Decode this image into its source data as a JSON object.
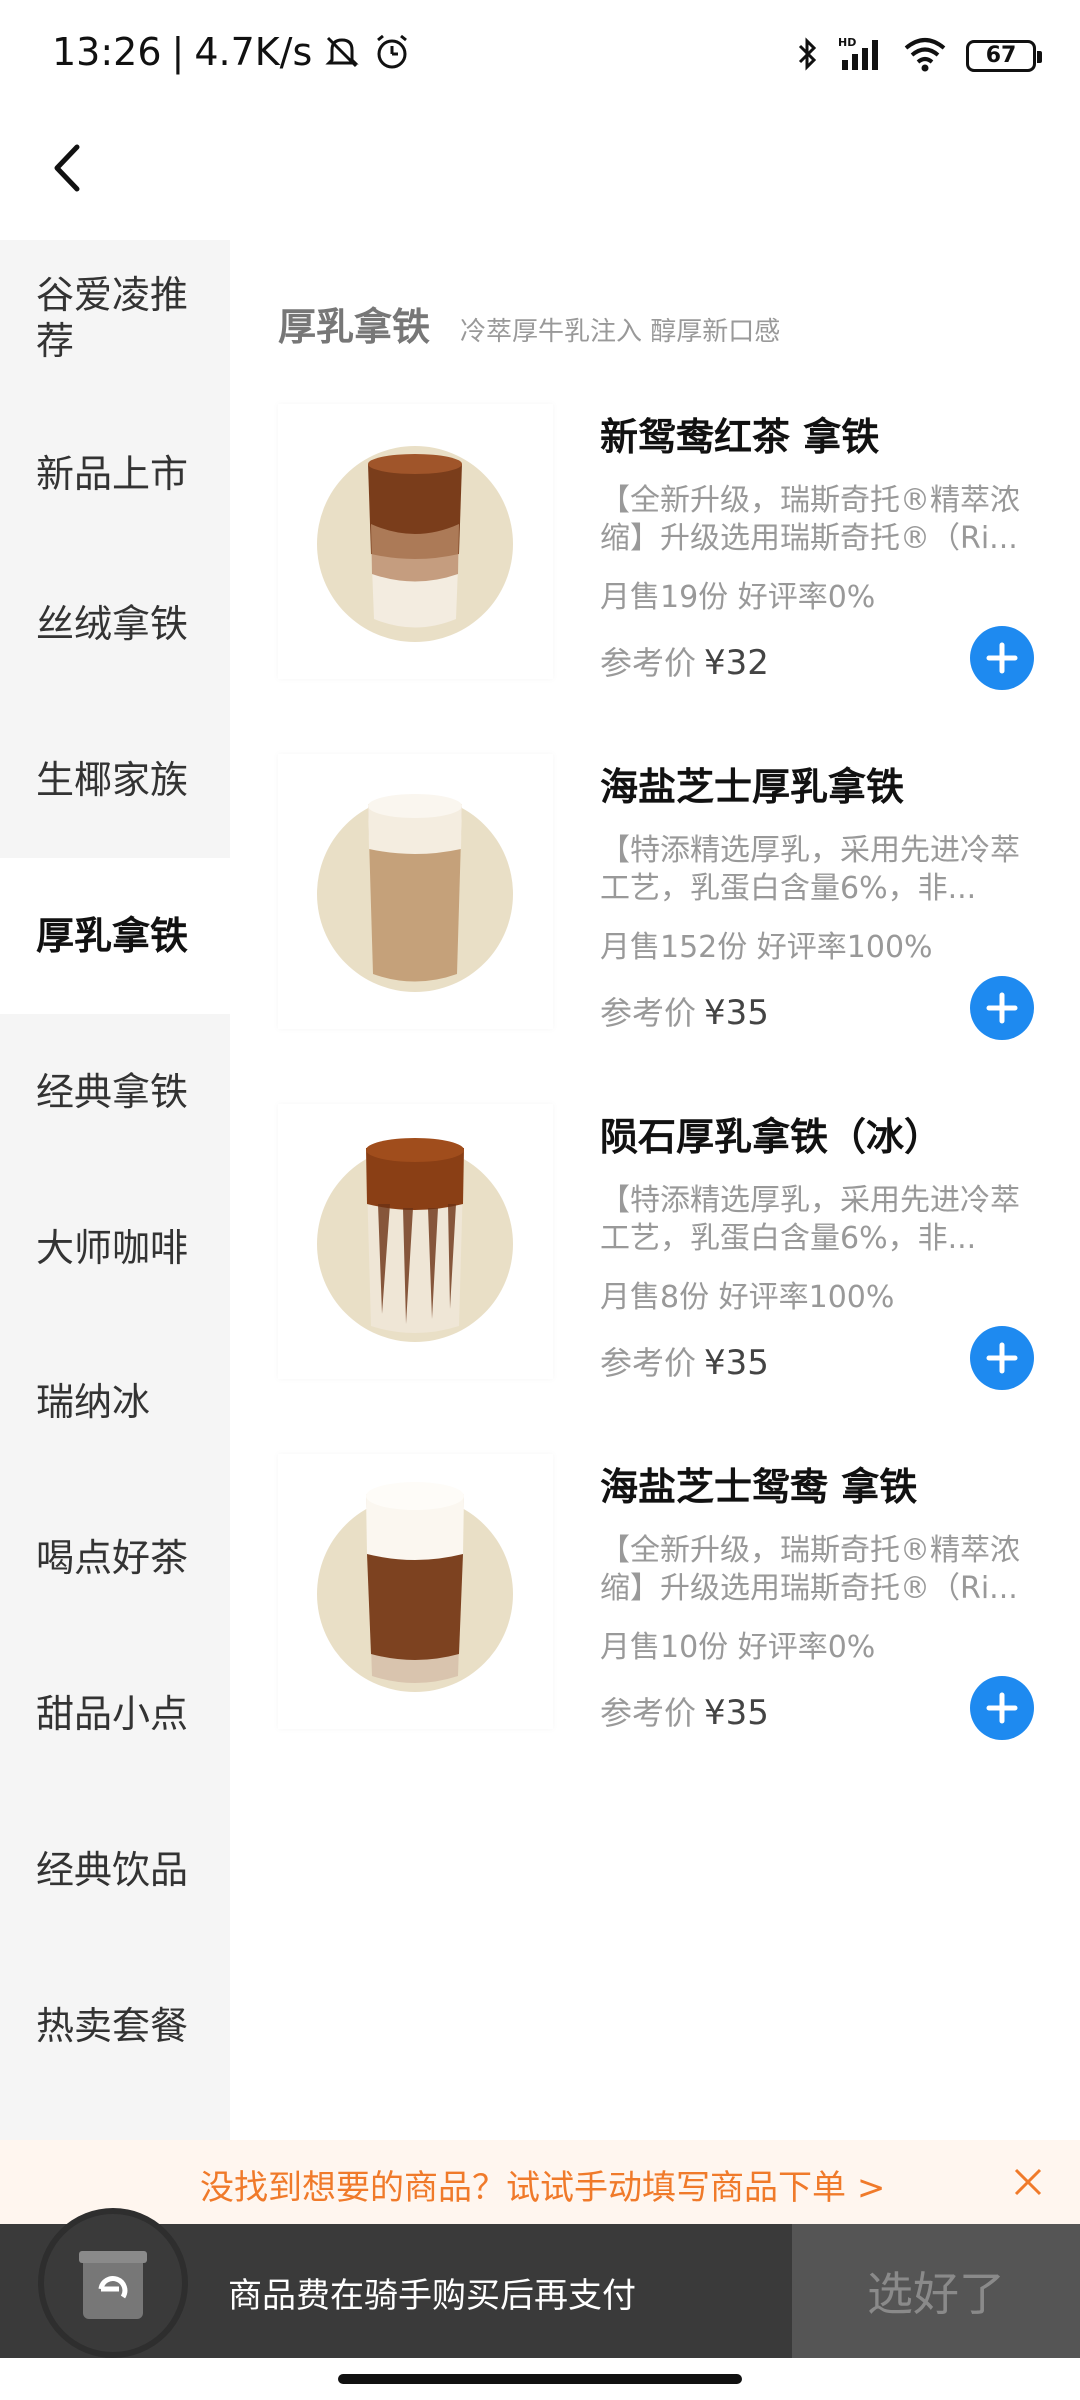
{
  "status_bar": {
    "time": "13:26",
    "network_speed": "4.7K/s",
    "battery": "67",
    "icons": [
      "mute-icon",
      "alarm-icon",
      "bluetooth-icon",
      "signal-icon",
      "wifi-icon",
      "battery-icon"
    ]
  },
  "sidebar": {
    "items": [
      {
        "label": "谷爱凌推荐",
        "active": false
      },
      {
        "label": "新品上市",
        "active": false
      },
      {
        "label": "丝绒拿铁",
        "active": false
      },
      {
        "label": "生椰家族",
        "active": false
      },
      {
        "label": "厚乳拿铁",
        "active": true
      },
      {
        "label": "经典拿铁",
        "active": false
      },
      {
        "label": "大师咖啡",
        "active": false
      },
      {
        "label": "瑞纳冰",
        "active": false
      },
      {
        "label": "喝点好茶",
        "active": false
      },
      {
        "label": "甜品小点",
        "active": false
      },
      {
        "label": "经典饮品",
        "active": false
      },
      {
        "label": "热卖套餐",
        "active": false
      }
    ]
  },
  "category": {
    "title": "厚乳拿铁",
    "subtitle": "冷萃厚牛乳注入 醇厚新口感"
  },
  "products": [
    {
      "name": "新鸳鸯红茶 拿铁",
      "desc": "【全新升级，瑞斯奇托®精萃浓缩】升级选用瑞斯奇托®（Ri...",
      "sales": "月售19份 好评率0%",
      "price_label": "参考价",
      "price": "¥32"
    },
    {
      "name": "海盐芝士厚乳拿铁",
      "desc": "【特添精选厚乳，采用先进冷萃工艺，乳蛋白含量6%，非...",
      "sales": "月售152份 好评率100%",
      "price_label": "参考价",
      "price": "¥35"
    },
    {
      "name": "陨石厚乳拿铁（冰）",
      "desc": "【特添精选厚乳，采用先进冷萃工艺，乳蛋白含量6%，非...",
      "sales": "月售8份 好评率100%",
      "price_label": "参考价",
      "price": "¥35"
    },
    {
      "name": "海盐芝士鸳鸯 拿铁",
      "desc": "【全新升级，瑞斯奇托®精萃浓缩】升级选用瑞斯奇托®（Ri...",
      "sales": "月售10份 好评率0%",
      "price_label": "参考价",
      "price": "¥35"
    }
  ],
  "tip_banner": {
    "text": "没找到想要的商品？试试手动填写商品下单",
    "arrow": ">"
  },
  "bottom_bar": {
    "text": "商品费在骑手购买后再支付",
    "confirm_label": "选好了"
  },
  "colors": {
    "accent_blue": "#1e8af0",
    "tip_orange": "#f07a2a",
    "sidebar_bg": "#f5f5f5",
    "bottom_dark": "#3a3a3a"
  }
}
